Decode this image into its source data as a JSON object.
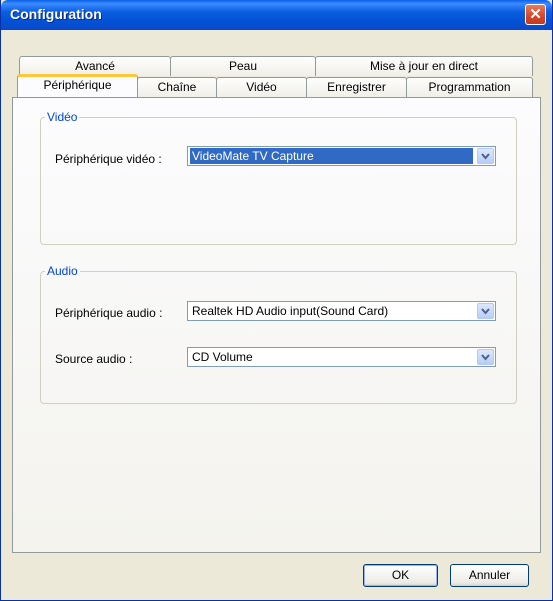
{
  "window": {
    "title": "Configuration"
  },
  "tabs": {
    "back_row": [
      {
        "label": "Avancé"
      },
      {
        "label": "Peau"
      },
      {
        "label": "Mise à jour en direct"
      }
    ],
    "front_row": [
      {
        "label": "Périphérique",
        "active": true
      },
      {
        "label": "Chaîne"
      },
      {
        "label": "Vidéo"
      },
      {
        "label": "Enregistrer"
      },
      {
        "label": "Programmation"
      }
    ]
  },
  "video_group": {
    "legend": "Vidéo",
    "device_label": "Périphérique vidéo :",
    "device_value": "VideoMate TV Capture"
  },
  "audio_group": {
    "legend": "Audio",
    "device_label": "Périphérique audio :",
    "device_value": "Realtek HD Audio input(Sound Card)",
    "source_label": "Source audio :",
    "source_value": "CD Volume"
  },
  "buttons": {
    "ok": "OK",
    "cancel": "Annuler"
  },
  "colors": {
    "title_bar": "#0a5fe8",
    "selection": "#316ac5",
    "legend": "#0046d5",
    "active_tab_highlight": "#ffc73c"
  }
}
